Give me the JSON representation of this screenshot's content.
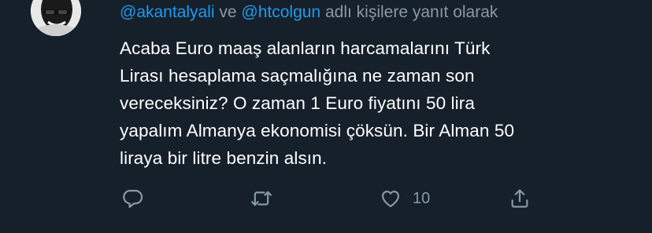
{
  "reply_context": {
    "prefix": "",
    "user1": "@akantalyali",
    "connector": " ve ",
    "user2": "@htcolgun",
    "suffix": " adlı kişilere yanıt olarak"
  },
  "tweet": {
    "lines": [
      "Acaba Euro maaş alanların harcamalarını Türk",
      "Lirası hesaplama saçmalığına ne zaman son",
      "vereceksiniz? O zaman 1 Euro fiyatını 50 lira",
      "yapalım Almanya ekonomisi çöksün. Bir Alman 50",
      "liraya bir litre benzin alsın."
    ]
  },
  "actions": {
    "reply_icon": "reply-icon",
    "retweet_icon": "retweet-icon",
    "like_icon": "like-icon",
    "like_count": "10",
    "share_icon": "share-icon"
  },
  "colors": {
    "background": "#15202b",
    "mention": "#1d9bf0",
    "secondary_text": "#8899a6",
    "primary_text": "#ffffff"
  }
}
